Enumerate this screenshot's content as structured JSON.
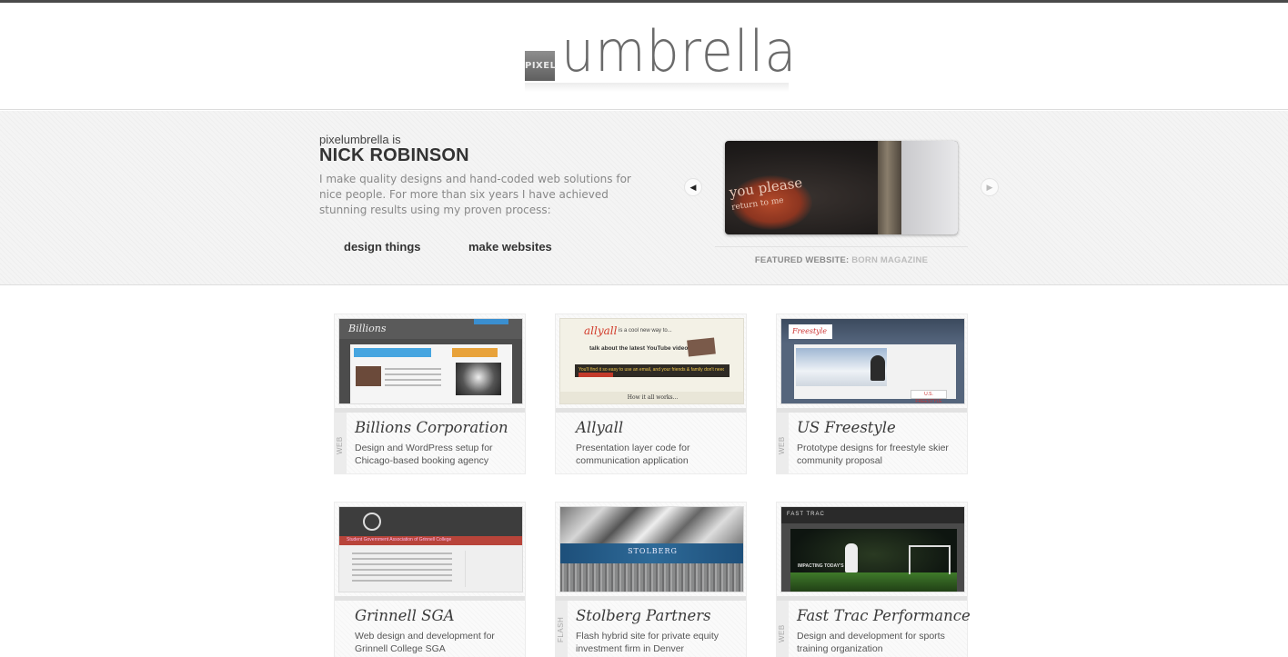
{
  "header": {
    "logo_box": "PIXEL",
    "logo_word": "umbrella"
  },
  "intro": {
    "pre": "pixelumbrella is",
    "name": "NICK ROBINSON",
    "description": "I make quality designs and hand-coded web solutions for nice people. For more than six years I have achieved stunning results using my proven process:",
    "link_design": "design things",
    "link_web": "make websites"
  },
  "featured": {
    "prev_icon": "◀",
    "next_icon": "▶",
    "image_caption": "you please",
    "image_caption_small": "return to me",
    "label": "FEATURED WEBSITE:",
    "name": "BORN MAGAZINE"
  },
  "thumbnails": {
    "billions_script": "Billions",
    "billions_news": "NEWS",
    "billions_artist": "ARTIST",
    "allyall_logo": "allyall",
    "allyall_tagline": "is a cool new way to...",
    "allyall_talk": "talk about the latest YouTube video.",
    "allyall_bar": "You'll find it so easy to use an email, and your friends & family don't need to sign up to join in.",
    "allyall_how": "How it all works...",
    "freestyle_logo": "Freestyle",
    "freestyle_badge": "U.S. FREESTYLE",
    "grinnell_bar": "Student Government Association of Grinnell College",
    "stolberg_name": "STOLBERG",
    "fasttrac_logo": "FAST TRAC",
    "fasttrac_text": "IMPACTING TODAY'S"
  },
  "portfolio": [
    {
      "tag": "WEB",
      "title": "Billions Corporation",
      "desc": "Design and WordPress setup for Chicago-based booking agency"
    },
    {
      "tag": "",
      "title": "Allyall",
      "desc": "Presentation layer code for communication application"
    },
    {
      "tag": "WEB",
      "title": "US Freestyle",
      "desc": "Prototype designs for freestyle skier community proposal"
    },
    {
      "tag": "",
      "title": "Grinnell SGA",
      "desc": "Web design and development for Grinnell College SGA"
    },
    {
      "tag": "FLASH",
      "title": "Stolberg Partners",
      "desc": "Flash hybrid site for private equity investment firm in Denver"
    },
    {
      "tag": "WEB",
      "title": "Fast Trac Performance",
      "desc": "Design and development for sports training organization"
    }
  ],
  "colors": {
    "background": "#ffffff",
    "band": "#f4f4f4",
    "text_dark": "#333333",
    "text_muted": "#888888"
  }
}
